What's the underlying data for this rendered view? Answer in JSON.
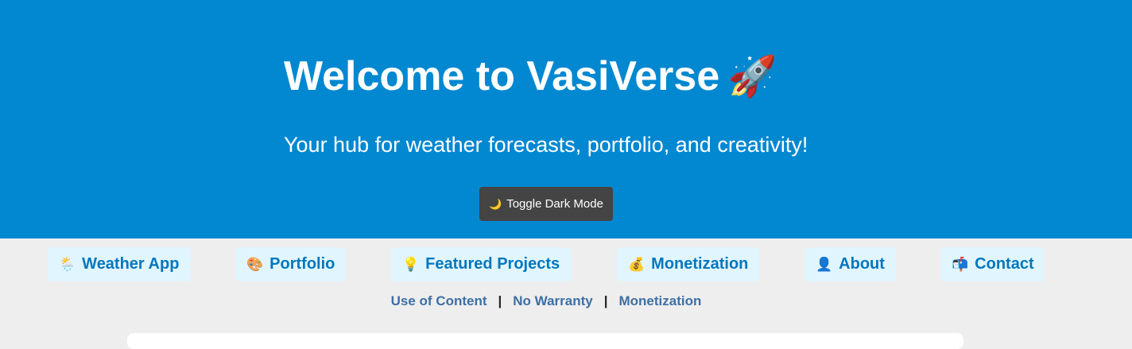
{
  "hero": {
    "title": "Welcome to VasiVerse",
    "title_emoji": "🚀",
    "subtitle": "Your hub for weather forecasts, portfolio, and creativity!",
    "toggle_icon": "🌙",
    "toggle_label": "Toggle Dark Mode",
    "background_color": "#0288d1"
  },
  "nav": {
    "items": [
      {
        "icon": "🌦️",
        "icon_name": "weather-icon",
        "label": "Weather App"
      },
      {
        "icon": "🎨",
        "icon_name": "palette-icon",
        "label": "Portfolio"
      },
      {
        "icon": "💡",
        "icon_name": "lightbulb-icon",
        "label": "Featured Projects"
      },
      {
        "icon": "💰",
        "icon_name": "money-bag-icon",
        "label": "Monetization"
      },
      {
        "icon": "👤",
        "icon_name": "person-icon",
        "label": "About"
      },
      {
        "icon": "📬",
        "icon_name": "mailbox-icon",
        "label": "Contact"
      }
    ],
    "item_background": "#e1f5fe",
    "item_color": "#0277bd"
  },
  "sublinks": {
    "items": [
      "Use of Content",
      "No Warranty",
      "Monetization"
    ],
    "separator": "|",
    "color": "#3d6fa4"
  }
}
